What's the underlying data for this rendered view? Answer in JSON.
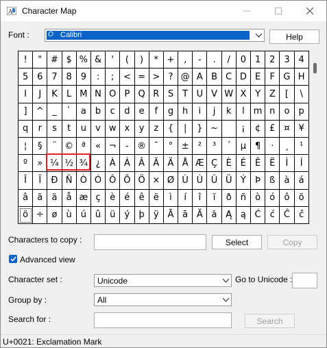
{
  "window": {
    "title": "Character Map"
  },
  "font": {
    "label": "Font :",
    "value": "Calibri"
  },
  "help_button": "Help",
  "grid": {
    "rows": [
      [
        "!",
        "\"",
        "#",
        "$",
        "%",
        "&",
        "'",
        "(",
        ")",
        "*",
        "+",
        ",",
        "-",
        ".",
        "/",
        "0",
        "1",
        "2",
        "3",
        "4"
      ],
      [
        "5",
        "6",
        "7",
        "8",
        "9",
        ":",
        ";",
        "<",
        "=",
        ">",
        "?",
        "@",
        "A",
        "B",
        "C",
        "D",
        "E",
        "F",
        "G",
        "H"
      ],
      [
        "I",
        "J",
        "K",
        "L",
        "M",
        "N",
        "O",
        "P",
        "Q",
        "R",
        "S",
        "T",
        "U",
        "V",
        "W",
        "X",
        "Y",
        "Z",
        "[",
        "\\"
      ],
      [
        "]",
        "^",
        "_",
        "`",
        "a",
        "b",
        "c",
        "d",
        "e",
        "f",
        "g",
        "h",
        "i",
        "j",
        "k",
        "l",
        "m",
        "n",
        "o",
        "p"
      ],
      [
        "q",
        "r",
        "s",
        "t",
        "u",
        "v",
        "w",
        "x",
        "y",
        "z",
        "{",
        "|",
        "}",
        "~",
        "",
        "¡",
        "¢",
        "£",
        "¤",
        "¥"
      ],
      [
        "¦",
        "§",
        "¨",
        "©",
        "ª",
        "«",
        "¬",
        "-",
        "®",
        "¯",
        "°",
        "±",
        "²",
        "³",
        "´",
        "µ",
        "¶",
        "·",
        "¸",
        "¹"
      ],
      [
        "º",
        "»",
        "¼",
        "½",
        "¾",
        "¿",
        "À",
        "Á",
        "Â",
        "Ã",
        "Ä",
        "Å",
        "Æ",
        "Ç",
        "È",
        "É",
        "Ê",
        "Ë",
        "Ì",
        "Í"
      ],
      [
        "Î",
        "Ï",
        "Ð",
        "Ñ",
        "Ò",
        "Ó",
        "Ô",
        "Õ",
        "Ö",
        "×",
        "Ø",
        "Ù",
        "Ú",
        "Û",
        "Ü",
        "Ý",
        "Þ",
        "ß",
        "à",
        "á"
      ],
      [
        "â",
        "ã",
        "ä",
        "å",
        "æ",
        "ç",
        "è",
        "é",
        "ê",
        "ë",
        "ì",
        "í",
        "î",
        "ï",
        "ð",
        "ñ",
        "ò",
        "ó",
        "ô",
        "õ"
      ],
      [
        "ö",
        "÷",
        "ø",
        "ù",
        "ú",
        "û",
        "ü",
        "ý",
        "þ",
        "ÿ",
        "Ā",
        "ā",
        "Ă",
        "ă",
        "Ą",
        "ą",
        "Ć",
        "ć",
        "Ĉ",
        "ĉ"
      ]
    ]
  },
  "copy": {
    "label": "Characters to copy :",
    "value": "",
    "select_button": "Select",
    "copy_button": "Copy"
  },
  "advanced_view": {
    "label": "Advanced view",
    "checked": true
  },
  "character_set": {
    "label": "Character set :",
    "value": "Unicode"
  },
  "goto_unicode": {
    "label": "Go to Unicode :",
    "value": ""
  },
  "group_by": {
    "label": "Group by :",
    "value": "All"
  },
  "search": {
    "label": "Search for :",
    "value": "",
    "button": "Search"
  },
  "status": {
    "text": "U+0021: Exclamation Mark"
  },
  "colors": {
    "accent": "#0a63c6",
    "highlight": "#e02020"
  }
}
